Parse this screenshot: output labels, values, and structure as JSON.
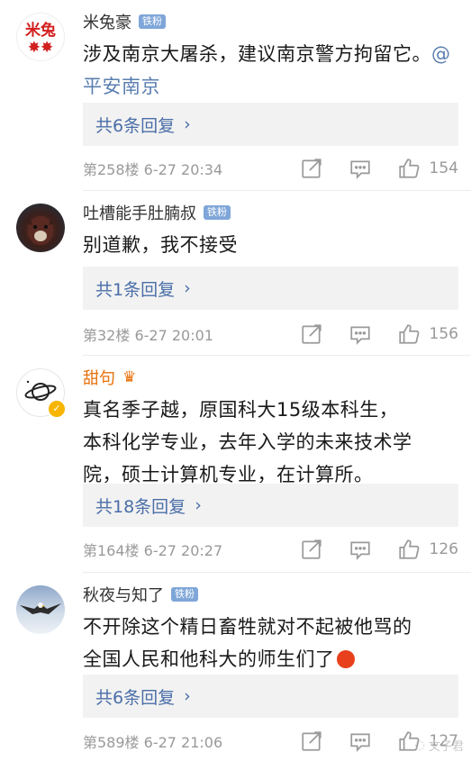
{
  "comments": [
    {
      "username": "米兔豪",
      "badge": "铁粉",
      "avatar_text": "米兔",
      "text": "涉及南京大屠杀，建议南京警方拘留它。",
      "mention": "@平安南京",
      "replies": "共6条回复",
      "floor": "第258楼",
      "time": "6-27 20:34",
      "likes": "154"
    },
    {
      "username": "吐槽能手肚腩叔",
      "badge": "铁粉",
      "text": "别道歉，我不接受",
      "replies": "共1条回复",
      "floor": "第32楼",
      "time": "6-27 20:01",
      "likes": "156"
    },
    {
      "username": "甜句",
      "vip_icon": "crown-icon",
      "text_line1": "真名季子越，原国科大15级本科生，",
      "text_line2": "本科化学专业，去年入学的未来技术学",
      "text_line3": "院，硕士计算机专业，在计算所。",
      "replies": "共18条回复",
      "floor": "第164楼",
      "time": "6-27 20:27",
      "likes": "126"
    },
    {
      "username": "秋夜与知了",
      "badge": "铁粉",
      "text_line1": "不开除这个精日畜牲就对不起被他骂的",
      "text_line2": "全国人民和他科大的师生们了",
      "replies": "共6条回复",
      "floor": "第589楼",
      "time": "6-27 21:06",
      "likes": "127"
    }
  ],
  "watermark": "文子君",
  "colors": {
    "link": "#4a6ea8",
    "badge_bg": "#7fa6d8",
    "vip_name": "#e8700a",
    "meta": "#999999"
  }
}
